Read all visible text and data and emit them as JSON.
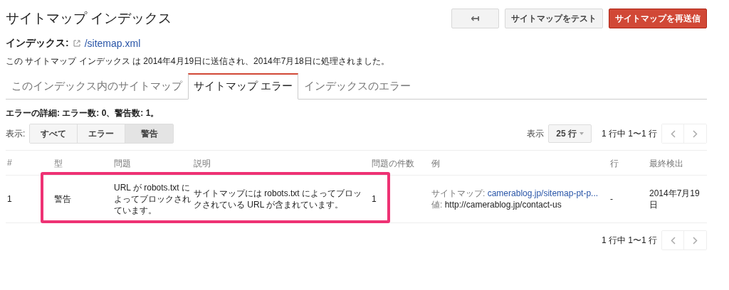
{
  "title": "サイトマップ インデックス",
  "actions": [
    {
      "kind": "back",
      "label": "↤"
    },
    {
      "kind": "plain",
      "label": "サイトマップをテスト"
    },
    {
      "kind": "primary",
      "label": "サイトマップを再送信"
    }
  ],
  "index": {
    "label": "インデックス:",
    "link": "/sitemap.xml"
  },
  "description": "この サイトマップ インデックス は 2014年4月19日に送信され、2014年7月18日に処理されました。",
  "tabs": [
    {
      "label": "このインデックス内のサイトマップ",
      "selected": false
    },
    {
      "label": "サイトマップ エラー",
      "selected": true
    },
    {
      "label": "インデックスのエラー",
      "selected": false
    }
  ],
  "details": "エラーの詳細: エラー数: 0、警告数: 1。",
  "filter": {
    "label": "表示:",
    "options": [
      {
        "label": "すべて",
        "selected": false
      },
      {
        "label": "エラー",
        "selected": false
      },
      {
        "label": "警告",
        "selected": true
      }
    ]
  },
  "rows_per_page": {
    "label": "表示",
    "value": "25 行"
  },
  "pagination": {
    "top": "1 行中 1〜1 行",
    "bottom": "1 行中 1〜1 行"
  },
  "table": {
    "columns": [
      "#",
      "型",
      "問題",
      "説明",
      "問題の件数",
      "例",
      "行",
      "最終検出"
    ],
    "rows": [
      {
        "highlighted": true,
        "number": "1",
        "type": "警告",
        "issue": "URL が robots.txt によってブロックされています。",
        "description": "サイトマップには robots.txt によってブロックされている URL が含まれています。",
        "count": "1",
        "example_sitemap_label": "サイトマップ:",
        "example_sitemap": "camerablog.jp/sitemap-pt-p...",
        "example_value_label": "値:",
        "example_value": "http://camerablog.jp/contact-us",
        "line": "-",
        "last_detected": "2014年7月19日"
      }
    ]
  }
}
